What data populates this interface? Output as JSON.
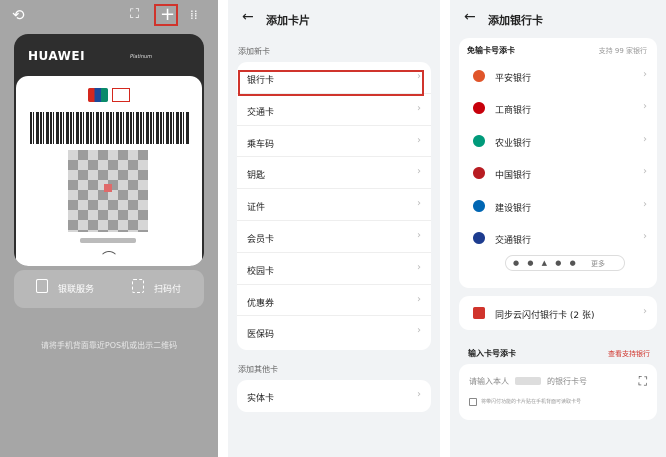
{
  "panel1": {
    "brand": "HUAWEI",
    "brand_sub": "Platinum",
    "unionpay_logo": "unionpay-logo-icon",
    "quickpass_logo": "quickpass-logo-icon",
    "actions": [
      {
        "label": "银联服务",
        "icon": "card-service-icon"
      },
      {
        "label": "扫码付",
        "icon": "scan-pay-icon"
      }
    ],
    "hint": "请将手机背面靠近POS机或出示二维码",
    "highlight_color": "#d0342c"
  },
  "panel2": {
    "back_icon": "←",
    "title": "添加卡片",
    "section_new": "添加新卡",
    "items": [
      "银行卡",
      "交通卡",
      "乘车码",
      "钥匙",
      "证件",
      "会员卡",
      "校园卡",
      "优惠券",
      "医保码"
    ],
    "section_other": "添加其他卡",
    "other_items": [
      "实体卡"
    ]
  },
  "panel3": {
    "back_icon": "←",
    "title": "添加银行卡",
    "free_section": "免输卡号添卡",
    "support_count": "支持 99 家银行",
    "banks": [
      "平安银行",
      "工商银行",
      "农业银行",
      "中国银行",
      "建设银行",
      "交通银行"
    ],
    "bank_colors": [
      "#e0552a",
      "#c7000b",
      "#009a7a",
      "#b81c22",
      "#0066b3",
      "#1d3c8f"
    ],
    "more_label": "更多",
    "sync_label": "同步云闪付银行卡 (2 张)",
    "manual_section": "输入卡号添卡",
    "view_supported": "查看支持银行",
    "input_placeholder_pre": "请输入本人",
    "input_placeholder_post": "的银行卡号",
    "nfc_hint": "将带闪付功能的卡片贴在手机背面可读取卡号",
    "accent_color": "#d0342c"
  }
}
